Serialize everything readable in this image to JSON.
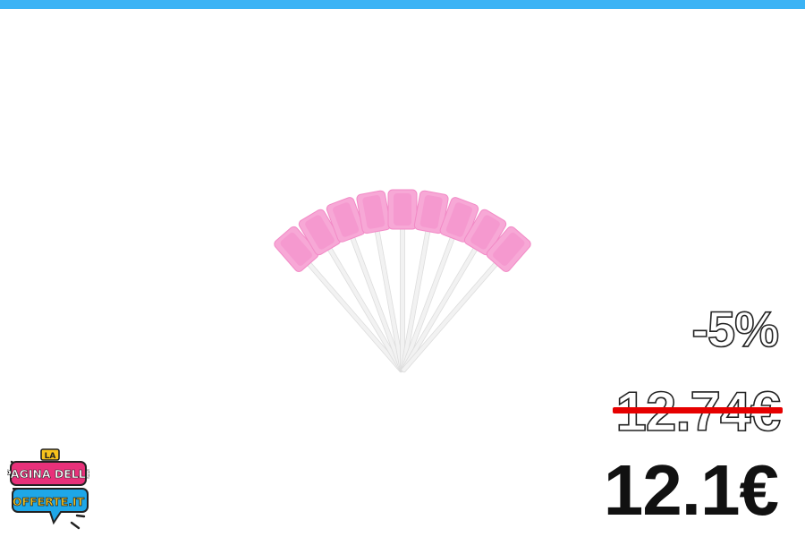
{
  "colors": {
    "top_bar": "#3bb3f5",
    "strike": "#e60000",
    "sponge": "#f7a8d6",
    "stick": "#f2f2f2",
    "logo_pink": "#e8317a",
    "logo_blue": "#1ea7e8",
    "logo_yellow": "#f7c21c"
  },
  "product": {
    "image_icon": "pink-sponge-swabs-image"
  },
  "price": {
    "discount": "-5%",
    "old": "12.74€",
    "new": "12.1€"
  },
  "logo": {
    "line1": "LA",
    "line2": "PAGINA DELLE",
    "line3": "OFFERTE.IT"
  }
}
